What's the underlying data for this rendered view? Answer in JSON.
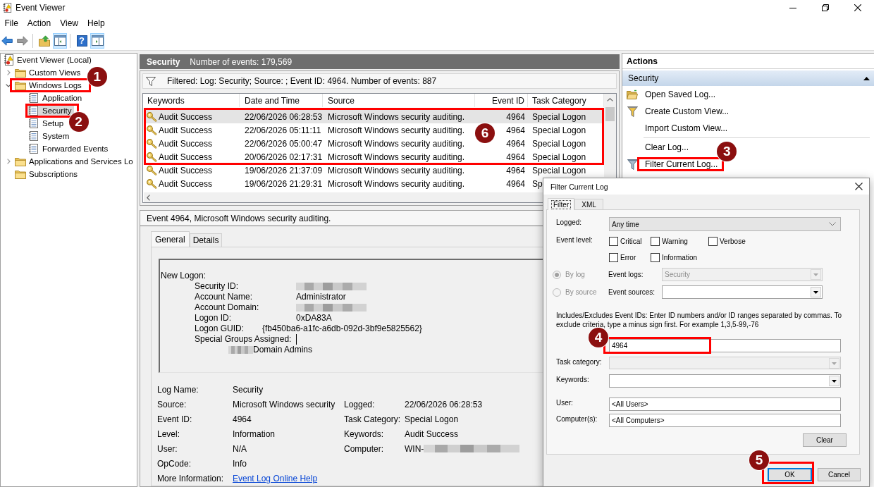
{
  "window": {
    "title": "Event Viewer"
  },
  "menu": [
    "File",
    "Action",
    "View",
    "Help"
  ],
  "toolbar": [
    [
      {
        "kind": "back",
        "disabled": false,
        "pressed": false
      },
      {
        "kind": "forward",
        "disabled": true,
        "pressed": false
      }
    ],
    [
      {
        "kind": "up",
        "disabled": false,
        "pressed": false
      },
      {
        "kind": "tree",
        "disabled": false,
        "pressed": true
      }
    ],
    [
      {
        "kind": "help",
        "glyph": "?",
        "disabled": false,
        "pressed": false
      },
      {
        "kind": "actions",
        "disabled": false,
        "pressed": true
      }
    ]
  ],
  "tree": [
    {
      "label": "Event Viewer (Local)",
      "kind": "root",
      "selected": false,
      "children": [
        {
          "label": "Custom Views",
          "kind": "folder",
          "selected": false,
          "expanded": false
        },
        {
          "label": "Windows Logs",
          "kind": "folder",
          "selected": false,
          "expanded": true,
          "callout": "1",
          "children": [
            {
              "label": "Application",
              "kind": "log",
              "selected": false
            },
            {
              "label": "Security",
              "kind": "log",
              "selected": true,
              "callout": "2"
            },
            {
              "label": "Setup",
              "kind": "log",
              "selected": false
            },
            {
              "label": "System",
              "kind": "log",
              "selected": false
            },
            {
              "label": "Forwarded Events",
              "kind": "log",
              "selected": false
            }
          ]
        },
        {
          "label": "Applications and Services Lo",
          "kind": "folder",
          "selected": false,
          "expanded": false
        },
        {
          "label": "Subscriptions",
          "kind": "folder",
          "selected": false
        }
      ]
    }
  ],
  "log_header": {
    "title": "Security",
    "count": "Number of events: 179,569"
  },
  "filter_bar": "Filtered: Log: Security; Source: ; Event ID: 4964. Number of events: 887",
  "event_list": {
    "columns": [
      "Keywords",
      "Date and Time",
      "Source",
      "Event ID",
      "Task Category"
    ],
    "callout": "6",
    "rows": [
      {
        "cells": [
          "Audit Success",
          "22/06/2026 06:28:53",
          "Microsoft Windows security auditing.",
          "4964",
          "Special Logon"
        ],
        "selected": true,
        "framed": true
      },
      {
        "cells": [
          "Audit Success",
          "22/06/2026 05:11:11",
          "Microsoft Windows security auditing.",
          "4964",
          "Special Logon"
        ],
        "selected": false,
        "framed": true
      },
      {
        "cells": [
          "Audit Success",
          "22/06/2026 05:00:47",
          "Microsoft Windows security auditing.",
          "4964",
          "Special Logon"
        ],
        "selected": false,
        "framed": true
      },
      {
        "cells": [
          "Audit Success",
          "20/06/2026 02:17:31",
          "Microsoft Windows security auditing.",
          "4964",
          "Special Logon"
        ],
        "selected": false,
        "framed": true
      },
      {
        "cells": [
          "Audit Success",
          "19/06/2026 21:37:09",
          "Microsoft Windows security auditing.",
          "4964",
          "Special Logon"
        ],
        "selected": false,
        "framed": false
      },
      {
        "cells": [
          "Audit Success",
          "19/06/2026 21:29:31",
          "Microsoft Windows security auditing.",
          "4964",
          "Sp"
        ],
        "selected": false,
        "framed": false
      }
    ]
  },
  "details": {
    "title": "Event 4964, Microsoft Windows security auditing.",
    "tabs": [
      {
        "label": "General",
        "selected": true
      },
      {
        "label": "Details",
        "selected": false
      }
    ],
    "description": [
      {
        "text": "New Logon:",
        "children": [
          {
            "text": "Security ID:\t\t",
            "redacted_after": true
          },
          {
            "text": "Account Name:\t\tAdministrator"
          },
          {
            "text": "Account Domain:\t\t",
            "redacted_after": true
          },
          {
            "text": "Logon ID:\t\t0xDA83A"
          },
          {
            "text": "Logon GUID:\t{fb450ba6-a1fc-a6db-092d-3bf9e5825562}"
          },
          {
            "text": "Special Groups Assigned:\t",
            "caret": true,
            "children": [
              {
                "text": "Domain Admins",
                "redacted_before": true
              }
            ]
          }
        ]
      }
    ],
    "properties": [
      [
        {
          "label": "Log Name:",
          "value": "Security",
          "kind": "text"
        }
      ],
      [
        {
          "label": "Source:",
          "value": "Microsoft Windows security",
          "kind": "text"
        },
        {
          "label": "Logged:",
          "value": "22/06/2026 06:28:53",
          "kind": "text"
        }
      ],
      [
        {
          "label": "Event ID:",
          "value": "4964",
          "kind": "text"
        },
        {
          "label": "Task Category:",
          "value": "Special Logon",
          "kind": "text"
        }
      ],
      [
        {
          "label": "Level:",
          "value": "Information",
          "kind": "text"
        },
        {
          "label": "Keywords:",
          "value": "Audit Success",
          "kind": "text"
        }
      ],
      [
        {
          "label": "User:",
          "value": "N/A",
          "kind": "text"
        },
        {
          "label": "Computer:",
          "value": "WIN-",
          "kind": "text",
          "redacted_after": true
        }
      ],
      [
        {
          "label": "OpCode:",
          "value": "Info",
          "kind": "text"
        }
      ],
      [
        {
          "label": "More Information:",
          "value": "Event Log Online Help",
          "kind": "link"
        }
      ]
    ]
  },
  "actions": {
    "title": "Actions",
    "section": {
      "label": "Security",
      "expanded": true
    },
    "groups": [
      [
        {
          "label": "Open Saved Log...",
          "kind": "open"
        },
        {
          "label": "Create Custom View...",
          "kind": "create"
        },
        {
          "label": "Import Custom View...",
          "kind": "import"
        }
      ],
      [
        {
          "label": "Clear Log...",
          "kind": "clear"
        },
        {
          "label": "Filter Current Log...",
          "kind": "filter",
          "callout": "3"
        }
      ]
    ]
  },
  "filter_dialog": {
    "title": "Filter Current Log",
    "tabs": [
      {
        "label": "Filter",
        "selected": true
      },
      {
        "label": "XML",
        "selected": false
      }
    ],
    "logged": {
      "label": "Logged:",
      "value": "Any time"
    },
    "event_level": {
      "label": "Event level:",
      "options": [
        {
          "label": "Critical",
          "checked": false
        },
        {
          "label": "Warning",
          "checked": false
        },
        {
          "label": "Verbose",
          "checked": false
        },
        {
          "label": "Error",
          "checked": false
        },
        {
          "label": "Information",
          "checked": false
        }
      ]
    },
    "log_choice": [
      {
        "label": "By log",
        "selected": true,
        "disabled": true,
        "field": {
          "label": "Event logs:",
          "value": "Security",
          "disabled": true
        }
      },
      {
        "label": "By source",
        "selected": false,
        "disabled": true,
        "field": {
          "label": "Event sources:",
          "disabled": false
        }
      }
    ],
    "event_ids": {
      "hint": "Includes/Excludes Event IDs: Enter ID numbers and/or ID ranges separated by commas. To exclude criteria, type a minus sign first. For example 1,3,5-99,-76",
      "value": "4964",
      "callout": "4"
    },
    "task_category": {
      "label": "Task category:",
      "disabled": true
    },
    "keywords": {
      "label": "Keywords:",
      "disabled": false
    },
    "user": {
      "label": "User:",
      "value": "<All Users>"
    },
    "computers": {
      "label": "Computer(s):",
      "value": "<All Computers>"
    },
    "clear_button": "Clear",
    "buttons": [
      {
        "label": "OK",
        "default": true,
        "callout": "5"
      },
      {
        "label": "Cancel",
        "default": false
      }
    ]
  }
}
